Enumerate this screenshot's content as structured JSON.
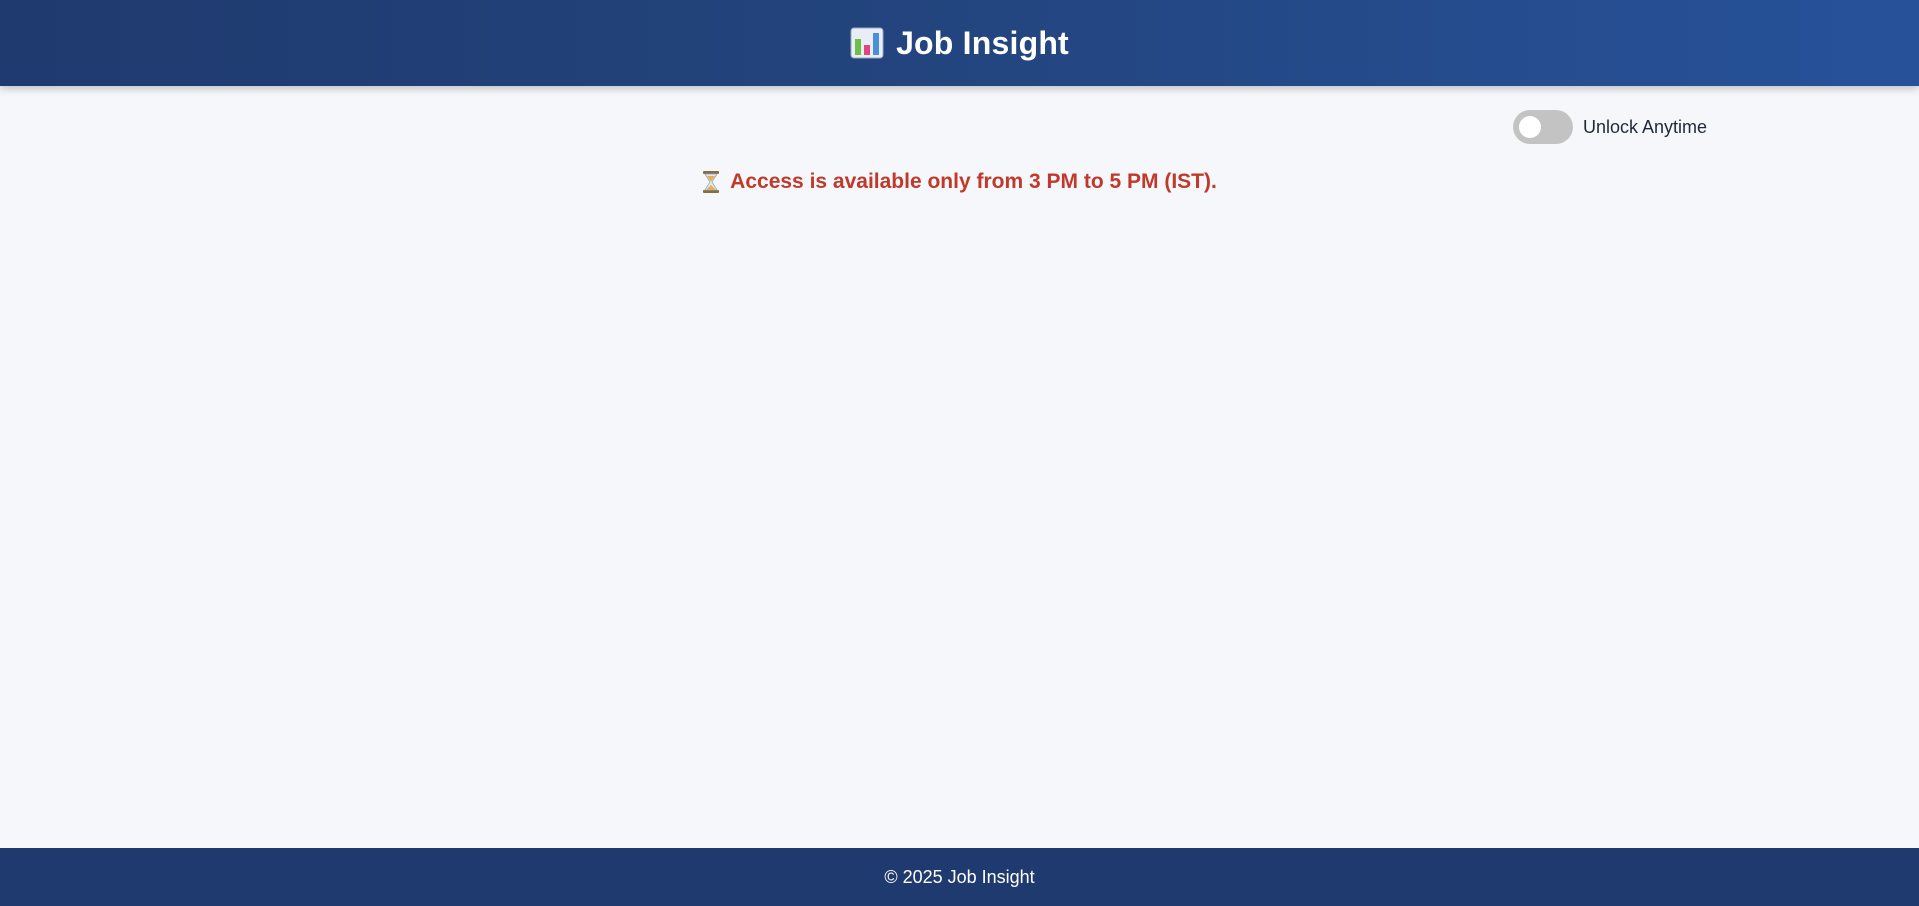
{
  "header": {
    "logo_icon": "bar-chart-icon",
    "title": "Job Insight",
    "gradient_colors": [
      "#1f3a6e",
      "#27529a"
    ]
  },
  "toggle": {
    "label": "Unlock Anytime",
    "checked": false,
    "track_color": "#c3c3c3"
  },
  "notice": {
    "icon": "hourglass-icon",
    "text": "Access is available only from 3 PM to 5 PM (IST).",
    "color": "#c0392b"
  },
  "footer": {
    "text": "© 2025 Job Insight",
    "background": "#1f3a6e"
  }
}
